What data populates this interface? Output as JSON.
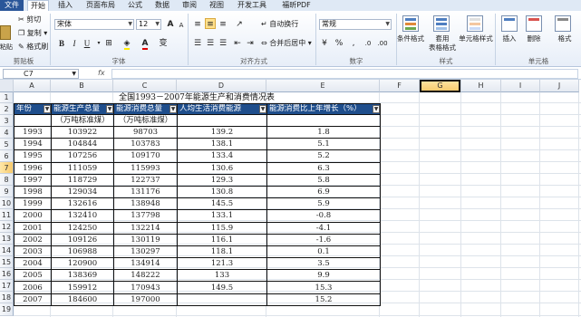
{
  "tabs": [
    "文件",
    "开始",
    "插入",
    "页面布局",
    "公式",
    "数据",
    "审阅",
    "视图",
    "开发工具",
    "福昕PDF"
  ],
  "clipboard": {
    "cut": "剪切",
    "copy": "复制",
    "format_painter": "格式刷",
    "paste": "粘贴",
    "group": "剪贴板"
  },
  "font": {
    "name": "宋体",
    "size": "12",
    "bold": "B",
    "italic": "I",
    "underline": "U",
    "grow": "A",
    "shrink": "A",
    "color_glyph": "A",
    "phonetic": "变",
    "group": "字体"
  },
  "alignment": {
    "wrap": "自动换行",
    "merge": "合并后居中",
    "group": "对齐方式"
  },
  "number": {
    "format": "常规",
    "group": "数字"
  },
  "styles": {
    "conditional": "条件格式",
    "table": "套用\n表格格式",
    "cell": "单元格样式",
    "group": "样式"
  },
  "cells": {
    "insert": "插入",
    "delete": "删除",
    "format": "格式",
    "group": "单元格"
  },
  "formula_bar": {
    "name_box": "C7",
    "fx": "fx",
    "content": ""
  },
  "columns": [
    "A",
    "B",
    "C",
    "D",
    "E",
    "F",
    "G",
    "H",
    "I",
    "J"
  ],
  "rows": [
    "1",
    "2",
    "3",
    "4",
    "5",
    "6",
    "7",
    "8",
    "9",
    "10",
    "11",
    "12",
    "13",
    "14",
    "15",
    "16",
    "17",
    "18",
    "19"
  ],
  "sheet": {
    "title": "全国1993－2007年能源生产和消费情况表",
    "headers": [
      "年份",
      "能源生产总量",
      "能源消费总量",
      "人均生活消费能源",
      "能源消费比上年增长（%）"
    ],
    "units": [
      "",
      "（万吨标准煤）",
      "（万吨标准煤）",
      "",
      ""
    ],
    "records": [
      [
        "1993",
        "103922",
        "98703",
        "139.2",
        "1.8"
      ],
      [
        "1994",
        "104844",
        "103783",
        "138.1",
        "5.1"
      ],
      [
        "1995",
        "107256",
        "109170",
        "133.4",
        "5.2"
      ],
      [
        "1996",
        "111059",
        "115993",
        "130.6",
        "6.3"
      ],
      [
        "1997",
        "118729",
        "122737",
        "129.3",
        "5.8"
      ],
      [
        "1998",
        "129034",
        "131176",
        "130.8",
        "6.9"
      ],
      [
        "1999",
        "132616",
        "138948",
        "145.5",
        "5.9"
      ],
      [
        "2000",
        "132410",
        "137798",
        "133.1",
        "-0.8"
      ],
      [
        "2001",
        "124250",
        "132214",
        "115.9",
        "-4.1"
      ],
      [
        "2002",
        "109126",
        "130119",
        "116.1",
        "-1.6"
      ],
      [
        "2003",
        "106988",
        "130297",
        "118.1",
        "0.1"
      ],
      [
        "2004",
        "120900",
        "134914",
        "121.3",
        "3.5"
      ],
      [
        "2005",
        "138369",
        "148222",
        "133",
        "9.9"
      ],
      [
        "2006",
        "159912",
        "170943",
        "149.5",
        "15.3"
      ],
      [
        "2007",
        "184600",
        "197000",
        "",
        "15.2"
      ]
    ]
  }
}
